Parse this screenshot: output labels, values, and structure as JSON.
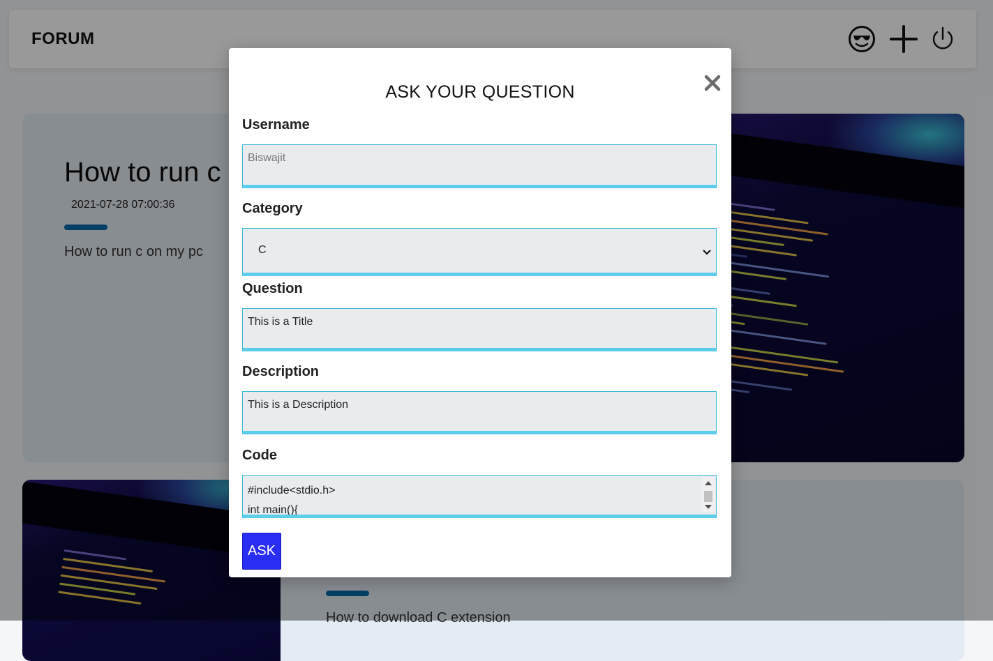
{
  "navbar": {
    "brand": "FORUM",
    "icons": [
      "sunglasses-face-icon",
      "plus-icon",
      "power-icon"
    ]
  },
  "posts": [
    {
      "title": "How to run c",
      "date": "2021-07-28 07:00:36",
      "excerpt": "How to run c on my pc"
    },
    {
      "title": "",
      "date": "",
      "excerpt": "How to download C extension"
    }
  ],
  "modal": {
    "title": "ASK YOUR QUESTION",
    "close_icon": "close-icon",
    "username": {
      "label": "Username",
      "placeholder": "Biswajit"
    },
    "category": {
      "label": "Category",
      "value": "C",
      "options": [
        "C"
      ]
    },
    "question": {
      "label": "Question",
      "value": "This is a Title"
    },
    "description": {
      "label": "Description",
      "value": "This is a Description"
    },
    "code": {
      "label": "Code",
      "lines": [
        "#include<stdio.h>",
        "int main(){"
      ]
    },
    "submit_label": "ASK"
  },
  "colors": {
    "accent_border": "#3bb8d6",
    "accent_underline": "#5ccdec",
    "button": "#2a2ef5",
    "card_bar": "#0a6aa8",
    "overlay": "rgba(0,0,0,0.40)"
  }
}
